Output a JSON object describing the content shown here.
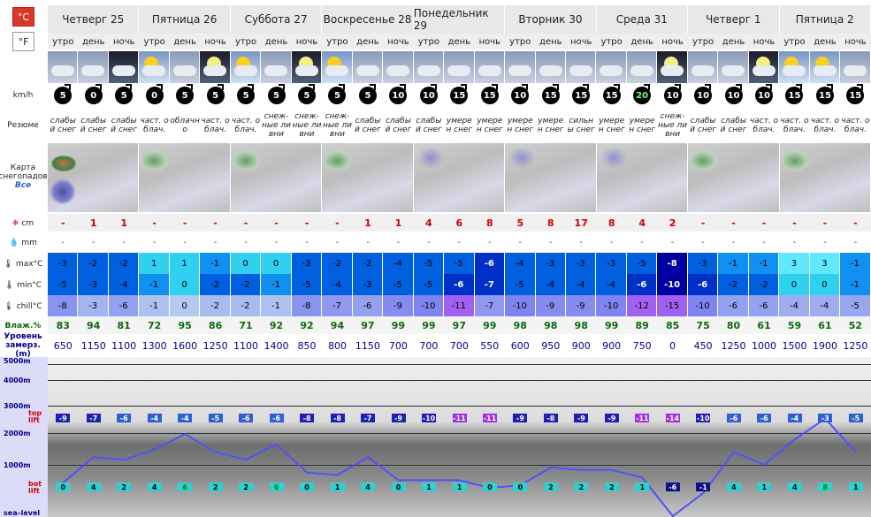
{
  "units": {
    "c": "°C",
    "f": "°F"
  },
  "days": [
    "Четверг 25",
    "Пятница 26",
    "Суббота 27",
    "Воскресенье 28",
    "Понедельник 29",
    "Вторник 30",
    "Среда 31",
    "Четверг 1",
    "Пятница 2"
  ],
  "tod": [
    "утро",
    "день",
    "ночь"
  ],
  "labels": {
    "wind": "km/h",
    "summary": "Резюме",
    "map": "Карта снегопадов",
    "map_all": "Все",
    "snow": "cm",
    "rain": "mm",
    "max": "max°C",
    "min": "min°C",
    "chill": "chill°C",
    "hum": "Влаж.%",
    "frz": "Уровень замерз. (m)",
    "top": "top lift",
    "bot": "bot lift",
    "sea": "sea–level"
  },
  "alt": [
    "5000m",
    "4000m",
    "3000m",
    "2000m",
    "1000m"
  ],
  "wind": [
    "5",
    "0",
    "5",
    "0",
    "5",
    "5",
    "5",
    "5",
    "5",
    "5",
    "5",
    "10",
    "10",
    "15",
    "15",
    "10",
    "15",
    "15",
    "15",
    "20",
    "10",
    "10",
    "10",
    "10",
    "15",
    "15",
    "15"
  ],
  "summary": [
    "слабый снег",
    "слабый снег",
    "слабый снег",
    "част. облач.",
    "облачн о",
    "част. облач.",
    "част. облач.",
    "снеж- ные ливни",
    "снеж- ные ливни",
    "снеж- ные ливни",
    "слабый снег",
    "слабый снег",
    "слабый снег",
    "умерен снег",
    "умерен снег",
    "умерен снег",
    "умерен снег",
    "сильны снег",
    "умерен снег",
    "умерен снег",
    "снеж- ные ливни",
    "слабый снег",
    "слабый снег",
    "част. облач.",
    "част. облач.",
    "част. облач.",
    "част. облач."
  ],
  "snow": [
    "-",
    "1",
    "1",
    "-",
    "-",
    "-",
    "-",
    "-",
    "-",
    "-",
    "1",
    "1",
    "4",
    "6",
    "8",
    "5",
    "8",
    "17",
    "8",
    "4",
    "2",
    "-",
    "-",
    "-",
    "-",
    "-",
    "-"
  ],
  "rain": [
    "-",
    "-",
    "-",
    "-",
    "-",
    "-",
    "-",
    "-",
    "-",
    "-",
    "-",
    "-",
    "-",
    "-",
    "-",
    "-",
    "-",
    "-",
    "-",
    "-",
    "-",
    "-",
    "-",
    "-",
    "-",
    "-",
    "-"
  ],
  "max": [
    "-3",
    "-2",
    "-2",
    "1",
    "1",
    "-1",
    "0",
    "0",
    "-3",
    "-2",
    "-2",
    "-4",
    "-5",
    "-5",
    "-6",
    "-4",
    "-3",
    "-3",
    "-3",
    "-5",
    "-8",
    "-3",
    "-1",
    "-1",
    "3",
    "3",
    "-1"
  ],
  "min": [
    "-5",
    "-3",
    "-4",
    "-1",
    "0",
    "-2",
    "-2",
    "-1",
    "-5",
    "-4",
    "-3",
    "-5",
    "-5",
    "-6",
    "-7",
    "-5",
    "-4",
    "-4",
    "-4",
    "-6",
    "-10",
    "-6",
    "-2",
    "-2",
    "0",
    "0",
    "-1"
  ],
  "chill": [
    "-8",
    "-3",
    "-6",
    "-1",
    "0",
    "-2",
    "-2",
    "-1",
    "-8",
    "-7",
    "-6",
    "-9",
    "-10",
    "-11",
    "-7",
    "-10",
    "-9",
    "-9",
    "-10",
    "-12",
    "-15",
    "-10",
    "-6",
    "-6",
    "-4",
    "-4",
    "-5"
  ],
  "hum": [
    "83",
    "94",
    "81",
    "72",
    "95",
    "86",
    "71",
    "92",
    "92",
    "94",
    "97",
    "99",
    "99",
    "97",
    "99",
    "98",
    "98",
    "98",
    "99",
    "89",
    "85",
    "75",
    "80",
    "61",
    "59",
    "61",
    "52"
  ],
  "frz": [
    "650",
    "1150",
    "1100",
    "1300",
    "1600",
    "1250",
    "1100",
    "1400",
    "850",
    "800",
    "1150",
    "700",
    "700",
    "700",
    "550",
    "600",
    "950",
    "900",
    "900",
    "750",
    "0",
    "450",
    "1250",
    "1000",
    "1500",
    "1900",
    "1250"
  ],
  "toplift": [
    "-9",
    "-7",
    "-6",
    "-4",
    "-4",
    "-5",
    "-6",
    "-6",
    "-8",
    "-8",
    "-7",
    "-9",
    "-10",
    "-11",
    "-11",
    "-9",
    "-8",
    "-9",
    "-9",
    "-11",
    "-14",
    "-10",
    "-6",
    "-6",
    "-4",
    "-3",
    "-5"
  ],
  "botlift": [
    "0",
    "4",
    "2",
    "4",
    "6",
    "2",
    "2",
    "6",
    "0",
    "1",
    "4",
    "0",
    "1",
    "1",
    "0",
    "0",
    "2",
    "2",
    "2",
    "1",
    "-6",
    "-1",
    "4",
    "1",
    "4",
    "8",
    "1"
  ]
}
